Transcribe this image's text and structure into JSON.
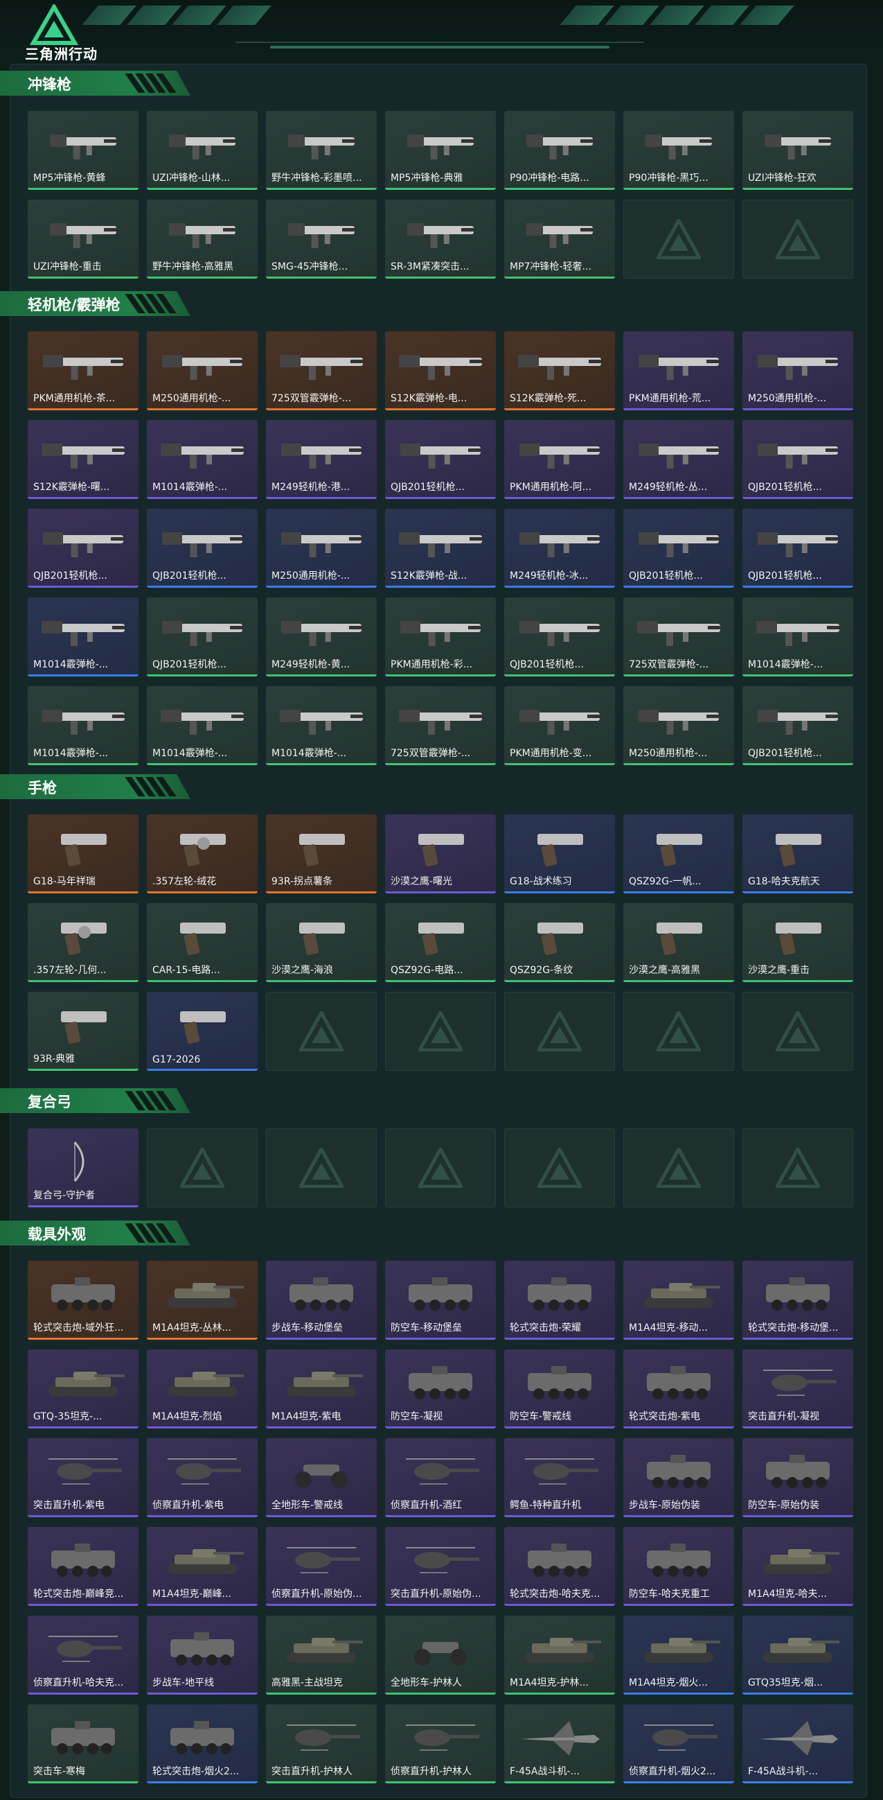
{
  "app": {
    "logo_text": "三角洲行动"
  },
  "colors": {
    "banner_green": "#217f48",
    "rarity_green": "#3fc36f",
    "rarity_purple": "#6f59d6",
    "rarity_orange": "#e0782c",
    "rarity_blue": "#3b7de8"
  },
  "sections": [
    {
      "title": "冲锋枪",
      "items": [
        {
          "label": "MP5冲锋枪-黄蜂",
          "rarity": "green",
          "icon": "smg-icon"
        },
        {
          "label": "UZI冲锋枪-山林...",
          "rarity": "green",
          "icon": "smg-icon"
        },
        {
          "label": "野牛冲锋枪-彩墨喷...",
          "rarity": "green",
          "icon": "smg-icon"
        },
        {
          "label": "MP5冲锋枪-典雅",
          "rarity": "green",
          "icon": "smg-icon"
        },
        {
          "label": "P90冲锋枪-电路...",
          "rarity": "green",
          "icon": "smg-icon"
        },
        {
          "label": "P90冲锋枪-黑巧...",
          "rarity": "green",
          "icon": "smg-icon"
        },
        {
          "label": "UZI冲锋枪-狂欢",
          "rarity": "green",
          "icon": "smg-icon"
        },
        {
          "label": "UZI冲锋枪-重击",
          "rarity": "green",
          "icon": "smg-icon"
        },
        {
          "label": "野牛冲锋枪-高雅黑",
          "rarity": "green",
          "icon": "smg-icon"
        },
        {
          "label": "SMG-45冲锋枪...",
          "rarity": "green",
          "icon": "smg-icon"
        },
        {
          "label": "SR-3M紧凑突击...",
          "rarity": "green",
          "icon": "smg-icon"
        },
        {
          "label": "MP7冲锋枪-轻奢...",
          "rarity": "green",
          "icon": "smg-icon"
        },
        {
          "label": "",
          "rarity": "empty",
          "icon": "empty-slot-icon"
        },
        {
          "label": "",
          "rarity": "empty",
          "icon": "empty-slot-icon"
        }
      ]
    },
    {
      "title": "轻机枪/霰弹枪",
      "items": [
        {
          "label": "PKM通用机枪-茶...",
          "rarity": "orange",
          "icon": "lmg-icon"
        },
        {
          "label": "M250通用机枪-...",
          "rarity": "orange",
          "icon": "lmg-icon"
        },
        {
          "label": "725双管霰弹枪-...",
          "rarity": "orange",
          "icon": "shotgun-icon"
        },
        {
          "label": "S12K霰弹枪-电...",
          "rarity": "orange",
          "icon": "shotgun-icon"
        },
        {
          "label": "S12K霰弹枪-死...",
          "rarity": "orange",
          "icon": "shotgun-icon"
        },
        {
          "label": "PKM通用机枪-荒...",
          "rarity": "purple",
          "icon": "lmg-icon"
        },
        {
          "label": "M250通用机枪-...",
          "rarity": "purple",
          "icon": "lmg-icon"
        },
        {
          "label": "S12K霰弹枪-曙...",
          "rarity": "purple",
          "icon": "shotgun-icon"
        },
        {
          "label": "M1014霰弹枪-...",
          "rarity": "purple",
          "icon": "shotgun-icon"
        },
        {
          "label": "M249轻机枪-港...",
          "rarity": "purple",
          "icon": "lmg-icon"
        },
        {
          "label": "QJB201轻机枪...",
          "rarity": "purple",
          "icon": "lmg-icon"
        },
        {
          "label": "PKM通用机枪-阿...",
          "rarity": "purple",
          "icon": "lmg-icon"
        },
        {
          "label": "M249轻机枪-丛...",
          "rarity": "purple",
          "icon": "lmg-icon"
        },
        {
          "label": "QJB201轻机枪...",
          "rarity": "purple",
          "icon": "lmg-icon"
        },
        {
          "label": "QJB201轻机枪...",
          "rarity": "purple",
          "icon": "lmg-icon"
        },
        {
          "label": "QJB201轻机枪...",
          "rarity": "blue",
          "icon": "lmg-icon"
        },
        {
          "label": "M250通用机枪-...",
          "rarity": "blue",
          "icon": "lmg-icon"
        },
        {
          "label": "S12K霰弹枪-战...",
          "rarity": "blue",
          "icon": "shotgun-icon"
        },
        {
          "label": "M249轻机枪-冰...",
          "rarity": "blue",
          "icon": "lmg-icon"
        },
        {
          "label": "QJB201轻机枪...",
          "rarity": "blue",
          "icon": "lmg-icon"
        },
        {
          "label": "QJB201轻机枪...",
          "rarity": "blue",
          "icon": "lmg-icon"
        },
        {
          "label": "M1014霰弹枪-...",
          "rarity": "blue",
          "icon": "shotgun-icon"
        },
        {
          "label": "QJB201轻机枪...",
          "rarity": "green",
          "icon": "lmg-icon"
        },
        {
          "label": "M249轻机枪-黄...",
          "rarity": "green",
          "icon": "lmg-icon"
        },
        {
          "label": "PKM通用机枪-彩...",
          "rarity": "green",
          "icon": "lmg-icon"
        },
        {
          "label": "QJB201轻机枪...",
          "rarity": "green",
          "icon": "lmg-icon"
        },
        {
          "label": "725双管霰弹枪-...",
          "rarity": "green",
          "icon": "shotgun-icon"
        },
        {
          "label": "M1014霰弹枪-...",
          "rarity": "green",
          "icon": "shotgun-icon"
        },
        {
          "label": "M1014霰弹枪-...",
          "rarity": "green",
          "icon": "shotgun-icon"
        },
        {
          "label": "M1014霰弹枪-...",
          "rarity": "green",
          "icon": "shotgun-icon"
        },
        {
          "label": "M1014霰弹枪-...",
          "rarity": "green",
          "icon": "shotgun-icon"
        },
        {
          "label": "725双管霰弹枪-...",
          "rarity": "green",
          "icon": "shotgun-icon"
        },
        {
          "label": "PKM通用机枪-变...",
          "rarity": "green",
          "icon": "lmg-icon"
        },
        {
          "label": "M250通用机枪-...",
          "rarity": "green",
          "icon": "lmg-icon"
        },
        {
          "label": "QJB201轻机枪...",
          "rarity": "green",
          "icon": "lmg-icon"
        }
      ]
    },
    {
      "title": "手枪",
      "items": [
        {
          "label": "G18-马年祥瑞",
          "rarity": "orange",
          "icon": "pistol-icon"
        },
        {
          "label": ".357左轮-绒花",
          "rarity": "orange",
          "icon": "revolver-icon"
        },
        {
          "label": "93R-拐点薯条",
          "rarity": "orange",
          "icon": "pistol-icon"
        },
        {
          "label": "沙漠之鹰-曙光",
          "rarity": "purple",
          "icon": "pistol-icon"
        },
        {
          "label": "G18-战术练习",
          "rarity": "blue",
          "icon": "pistol-icon"
        },
        {
          "label": "QSZ92G-一帆...",
          "rarity": "blue",
          "icon": "pistol-icon"
        },
        {
          "label": "G18-哈夫克航天",
          "rarity": "blue",
          "icon": "pistol-icon"
        },
        {
          "label": ".357左轮-几何...",
          "rarity": "green",
          "icon": "revolver-icon"
        },
        {
          "label": "CAR-15-电路...",
          "rarity": "green",
          "icon": "pistol-icon"
        },
        {
          "label": "沙漠之鹰-海浪",
          "rarity": "green",
          "icon": "pistol-icon"
        },
        {
          "label": "QSZ92G-电路...",
          "rarity": "green",
          "icon": "pistol-icon"
        },
        {
          "label": "QSZ92G-条纹",
          "rarity": "green",
          "icon": "pistol-icon"
        },
        {
          "label": "沙漠之鹰-高雅黑",
          "rarity": "green",
          "icon": "pistol-icon"
        },
        {
          "label": "沙漠之鹰-重击",
          "rarity": "green",
          "icon": "pistol-icon"
        },
        {
          "label": "93R-典雅",
          "rarity": "green",
          "icon": "pistol-icon"
        },
        {
          "label": "G17-2026",
          "rarity": "blue",
          "icon": "pistol-icon"
        },
        {
          "label": "",
          "rarity": "empty",
          "icon": "empty-slot-icon"
        },
        {
          "label": "",
          "rarity": "empty",
          "icon": "empty-slot-icon"
        },
        {
          "label": "",
          "rarity": "empty",
          "icon": "empty-slot-icon"
        },
        {
          "label": "",
          "rarity": "empty",
          "icon": "empty-slot-icon"
        },
        {
          "label": "",
          "rarity": "empty",
          "icon": "empty-slot-icon"
        }
      ]
    },
    {
      "title": "复合弓",
      "items": [
        {
          "label": "复合弓-守护者",
          "rarity": "purple",
          "icon": "bow-icon"
        },
        {
          "label": "",
          "rarity": "empty",
          "icon": "empty-slot-icon"
        },
        {
          "label": "",
          "rarity": "empty",
          "icon": "empty-slot-icon"
        },
        {
          "label": "",
          "rarity": "empty",
          "icon": "empty-slot-icon"
        },
        {
          "label": "",
          "rarity": "empty",
          "icon": "empty-slot-icon"
        },
        {
          "label": "",
          "rarity": "empty",
          "icon": "empty-slot-icon"
        },
        {
          "label": "",
          "rarity": "empty",
          "icon": "empty-slot-icon"
        }
      ]
    },
    {
      "title": "载具外观",
      "items": [
        {
          "label": "轮式突击炮-域外狂...",
          "rarity": "orange",
          "icon": "armored-car-icon"
        },
        {
          "label": "M1A4坦克-丛林...",
          "rarity": "orange",
          "icon": "tank-icon"
        },
        {
          "label": "步战车-移动堡垒",
          "rarity": "purple",
          "icon": "apc-icon"
        },
        {
          "label": "防空车-移动堡垒",
          "rarity": "purple",
          "icon": "apc-icon"
        },
        {
          "label": "轮式突击炮-荣耀",
          "rarity": "purple",
          "icon": "armored-car-icon"
        },
        {
          "label": "M1A4坦克-移动...",
          "rarity": "purple",
          "icon": "tank-icon"
        },
        {
          "label": "轮式突击炮-移动堡...",
          "rarity": "purple",
          "icon": "armored-car-icon"
        },
        {
          "label": "GTQ-35坦克-...",
          "rarity": "purple",
          "icon": "tank-icon"
        },
        {
          "label": "M1A4坦克-烈焰",
          "rarity": "purple",
          "icon": "tank-icon"
        },
        {
          "label": "M1A4坦克-紫电",
          "rarity": "purple",
          "icon": "tank-icon"
        },
        {
          "label": "防空车-凝视",
          "rarity": "purple",
          "icon": "apc-icon"
        },
        {
          "label": "防空车-警戒线",
          "rarity": "purple",
          "icon": "apc-icon"
        },
        {
          "label": "轮式突击炮-紫电",
          "rarity": "purple",
          "icon": "armored-car-icon"
        },
        {
          "label": "突击直升机-凝视",
          "rarity": "purple",
          "icon": "helicopter-icon"
        },
        {
          "label": "突击直升机-紫电",
          "rarity": "purple",
          "icon": "helicopter-icon"
        },
        {
          "label": "侦察直升机-紫电",
          "rarity": "purple",
          "icon": "helicopter-icon"
        },
        {
          "label": "全地形车-警戒线",
          "rarity": "purple",
          "icon": "atv-icon"
        },
        {
          "label": "侦察直升机-酒红",
          "rarity": "purple",
          "icon": "helicopter-icon"
        },
        {
          "label": "鳄鱼-特种直升机",
          "rarity": "purple",
          "icon": "helicopter-icon"
        },
        {
          "label": "步战车-原始伪装",
          "rarity": "purple",
          "icon": "apc-icon"
        },
        {
          "label": "防空车-原始伪装",
          "rarity": "purple",
          "icon": "apc-icon"
        },
        {
          "label": "轮式突击炮-巅峰竞...",
          "rarity": "purple",
          "icon": "armored-car-icon"
        },
        {
          "label": "M1A4坦克-巅峰...",
          "rarity": "purple",
          "icon": "tank-icon"
        },
        {
          "label": "侦察直升机-原始伪...",
          "rarity": "purple",
          "icon": "helicopter-icon"
        },
        {
          "label": "突击直升机-原始伪...",
          "rarity": "purple",
          "icon": "helicopter-icon"
        },
        {
          "label": "轮式突击炮-哈夫克...",
          "rarity": "purple",
          "icon": "armored-car-icon"
        },
        {
          "label": "防空车-哈夫克重工",
          "rarity": "purple",
          "icon": "apc-icon"
        },
        {
          "label": "M1A4坦克-哈夫...",
          "rarity": "purple",
          "icon": "tank-icon"
        },
        {
          "label": "侦察直升机-哈夫克...",
          "rarity": "purple",
          "icon": "helicopter-icon"
        },
        {
          "label": "步战车-地平线",
          "rarity": "purple",
          "icon": "apc-icon"
        },
        {
          "label": "高雅黑-主战坦克",
          "rarity": "green",
          "icon": "tank-icon"
        },
        {
          "label": "全地形车-护林人",
          "rarity": "green",
          "icon": "atv-icon"
        },
        {
          "label": "M1A4坦克-护林...",
          "rarity": "green",
          "icon": "tank-icon"
        },
        {
          "label": "M1A4坦克-烟火...",
          "rarity": "blue",
          "icon": "tank-icon"
        },
        {
          "label": "GTQ35坦克-烟...",
          "rarity": "blue",
          "icon": "tank-icon"
        },
        {
          "label": "突击车-寒梅",
          "rarity": "green",
          "icon": "armored-car-icon"
        },
        {
          "label": "轮式突击炮-烟火2...",
          "rarity": "blue",
          "icon": "armored-car-icon"
        },
        {
          "label": "突击直升机-护林人",
          "rarity": "green",
          "icon": "helicopter-icon"
        },
        {
          "label": "侦察直升机-护林人",
          "rarity": "green",
          "icon": "helicopter-icon"
        },
        {
          "label": "F-45A战斗机-...",
          "rarity": "green",
          "icon": "jet-icon"
        },
        {
          "label": "侦察直升机-烟火2...",
          "rarity": "blue",
          "icon": "helicopter-icon"
        },
        {
          "label": "F-45A战斗机-...",
          "rarity": "blue",
          "icon": "jet-icon"
        }
      ]
    }
  ]
}
